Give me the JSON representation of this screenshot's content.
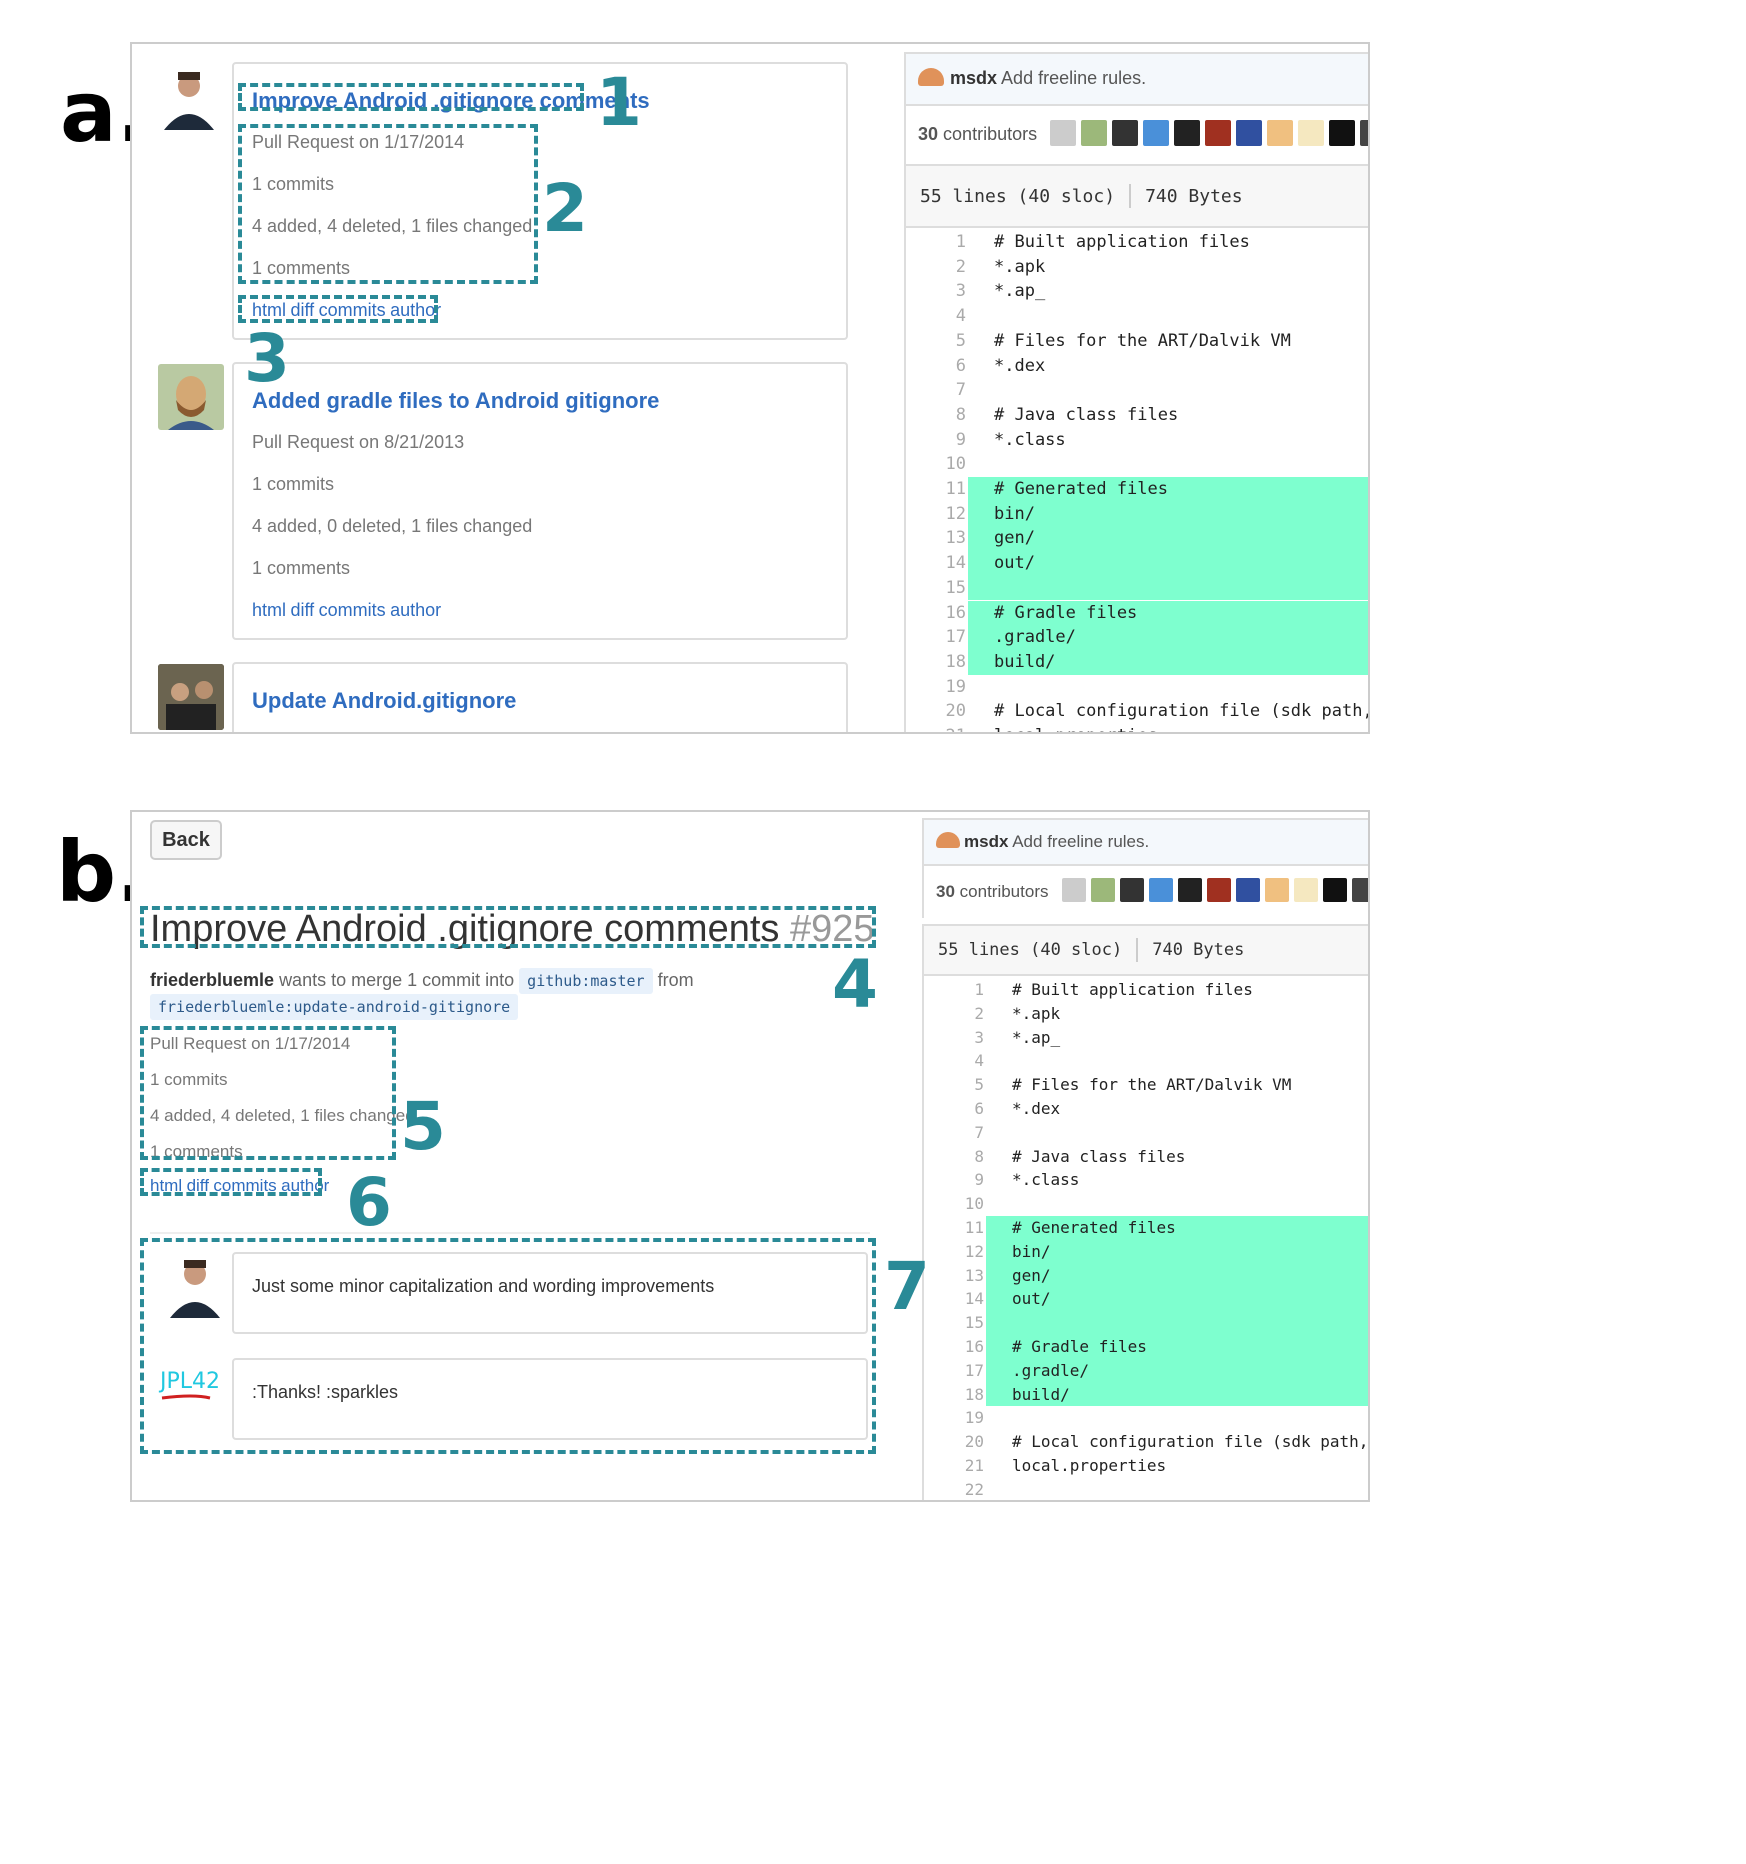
{
  "labels": {
    "a": "a.",
    "b": "b."
  },
  "callout_numbers": [
    "1",
    "2",
    "3",
    "4",
    "5",
    "6",
    "7"
  ],
  "panel_a": {
    "pull_requests": [
      {
        "title": "Improve Android .gitignore comments",
        "date": "Pull Request on 1/17/2014",
        "commits": "1 commits",
        "changes": "4 added, 4 deleted, 1 files changed",
        "comments": "1 comments",
        "links": [
          "html",
          "diff",
          "commits",
          "author"
        ]
      },
      {
        "title": "Added gradle files to Android gitignore",
        "date": "Pull Request on 8/21/2013",
        "commits": "1 commits",
        "changes": "4 added, 0 deleted, 1 files changed",
        "comments": "1 comments",
        "links": [
          "html",
          "diff",
          "commits",
          "author"
        ]
      },
      {
        "title": "Update Android.gitignore"
      }
    ]
  },
  "panel_b": {
    "back_label": "Back",
    "pr_title": "Improve Android .gitignore comments",
    "pr_number": "#925",
    "merge": {
      "user": "friederbluemle",
      "text": "wants to merge 1 commit into",
      "base": "github:master",
      "from": "from",
      "head": "friederbluemle:update-android-gitignore"
    },
    "meta": {
      "date": "Pull Request on 1/17/2014",
      "commits": "1 commits",
      "changes": "4 added, 4 deleted, 1 files changed",
      "comments": "1 comments"
    },
    "links": [
      "html",
      "diff",
      "commits",
      "author"
    ],
    "comments": [
      {
        "text": "Just some minor capitalization and wording improvements"
      },
      {
        "avatar_text": "JPL42",
        "text": ":Thanks! :sparkles"
      }
    ]
  },
  "file": {
    "commit_user": "msdx",
    "commit_msg": "Add freeline rules.",
    "contributors_count": "30",
    "contributors_label": "contributors",
    "lines_info": "55 lines (40 sloc)",
    "size_info": "740 Bytes",
    "lines": [
      {
        "n": "1",
        "t": "# Built application files"
      },
      {
        "n": "2",
        "t": "*.apk"
      },
      {
        "n": "3",
        "t": "*.ap_"
      },
      {
        "n": "4",
        "t": ""
      },
      {
        "n": "5",
        "t": "# Files for the ART/Dalvik VM"
      },
      {
        "n": "6",
        "t": "*.dex"
      },
      {
        "n": "7",
        "t": ""
      },
      {
        "n": "8",
        "t": "# Java class files"
      },
      {
        "n": "9",
        "t": "*.class"
      },
      {
        "n": "10",
        "t": ""
      },
      {
        "n": "11",
        "t": "# Generated files",
        "hl": true
      },
      {
        "n": "12",
        "t": "bin/",
        "hl": true
      },
      {
        "n": "13",
        "t": "gen/",
        "hl": true
      },
      {
        "n": "14",
        "t": "out/",
        "hl": true
      },
      {
        "n": "15",
        "t": "",
        "hl": true
      },
      {
        "n": "16",
        "t": "# Gradle files",
        "hl": true
      },
      {
        "n": "17",
        "t": ".gradle/",
        "hl": true
      },
      {
        "n": "18",
        "t": "build/",
        "hl": true
      },
      {
        "n": "19",
        "t": ""
      },
      {
        "n": "20",
        "t": "# Local configuration file (sdk path, etc)"
      },
      {
        "n": "21",
        "t": "local.properties"
      },
      {
        "n": "22",
        "t": ""
      }
    ]
  },
  "colors": {
    "accent": "#2a8a97",
    "link": "#2f6cbf",
    "highlight": "#7effcf"
  }
}
